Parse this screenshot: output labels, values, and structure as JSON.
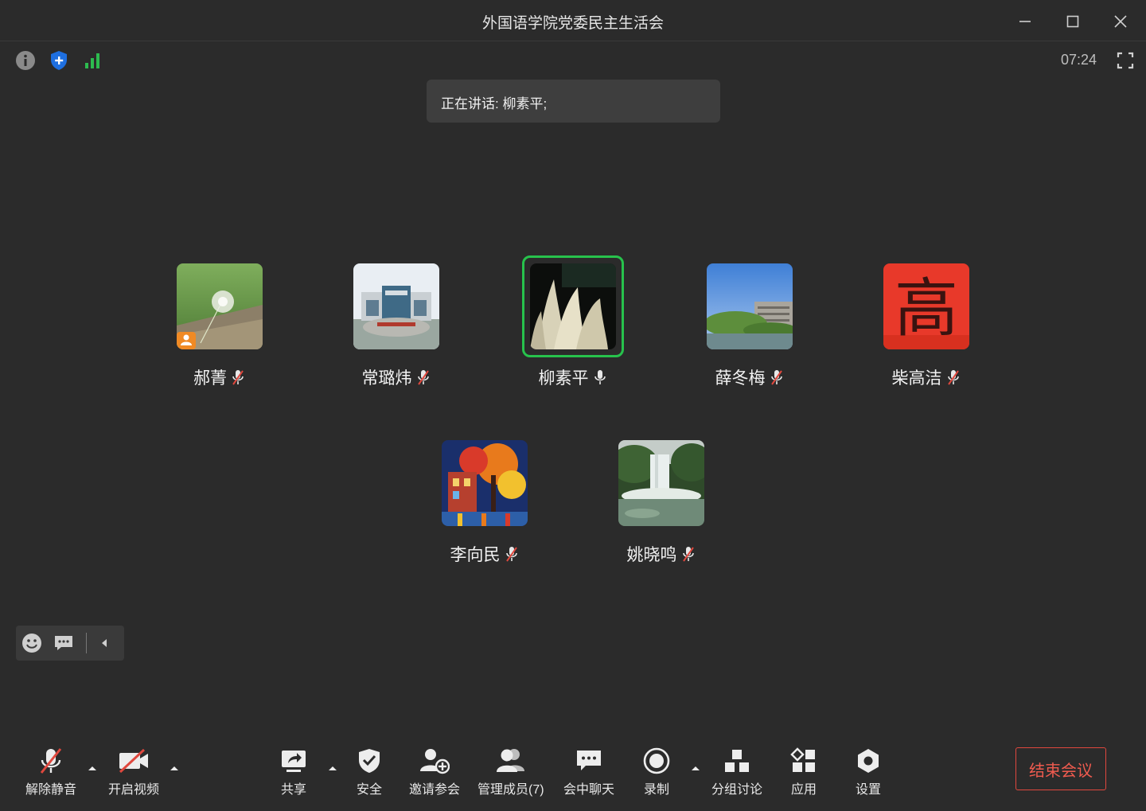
{
  "window": {
    "title": "外国语学院党委民主生活会",
    "controls": [
      "minimize-icon",
      "maximize-icon",
      "close-icon"
    ]
  },
  "status": {
    "icons": [
      "info-icon",
      "shield-icon",
      "signal-icon"
    ],
    "clock": "07:24",
    "colors": {
      "shield": "#1e6fe0",
      "signal": "#2dbb4f"
    }
  },
  "speaking": {
    "text": "正在讲话: 柳素平;"
  },
  "participants": [
    {
      "name": "郝菁",
      "mic": "muted",
      "is_host": true,
      "avatar": "dandelion"
    },
    {
      "name": "常璐炜",
      "mic": "muted",
      "is_host": false,
      "avatar": "campus-building"
    },
    {
      "name": "柳素平",
      "mic": "active",
      "is_host": false,
      "speaking": true,
      "avatar": "reeds-night"
    },
    {
      "name": "薛冬梅",
      "mic": "muted",
      "is_host": false,
      "avatar": "riverside-building"
    },
    {
      "name": "柴高洁",
      "mic": "muted",
      "is_host": false,
      "avatar": "red-gao-character",
      "avatar_text": "高"
    },
    {
      "name": "李向民",
      "mic": "muted",
      "is_host": false,
      "avatar": "painted-street"
    },
    {
      "name": "姚晓鸣",
      "mic": "muted",
      "is_host": false,
      "avatar": "waterfall"
    }
  ],
  "reactions": {
    "icons": [
      "emoji-icon",
      "chat-bubble-icon",
      "collapse-left-icon"
    ]
  },
  "toolbar": {
    "unmute": "解除静音",
    "start_video": "开启视频",
    "share": "共享",
    "security": "安全",
    "invite": "邀请参会",
    "manage_members": "管理成员(7)",
    "chat": "会中聊天",
    "record": "录制",
    "breakout": "分组讨论",
    "apps": "应用",
    "settings": "设置",
    "end_meeting": "结束会议"
  },
  "colors": {
    "background": "#2b2b2b",
    "speaking_border": "#27c24c",
    "end_meeting": "#e0483e",
    "muted_slash": "#e0483e",
    "host_badge": "#f08a24"
  }
}
